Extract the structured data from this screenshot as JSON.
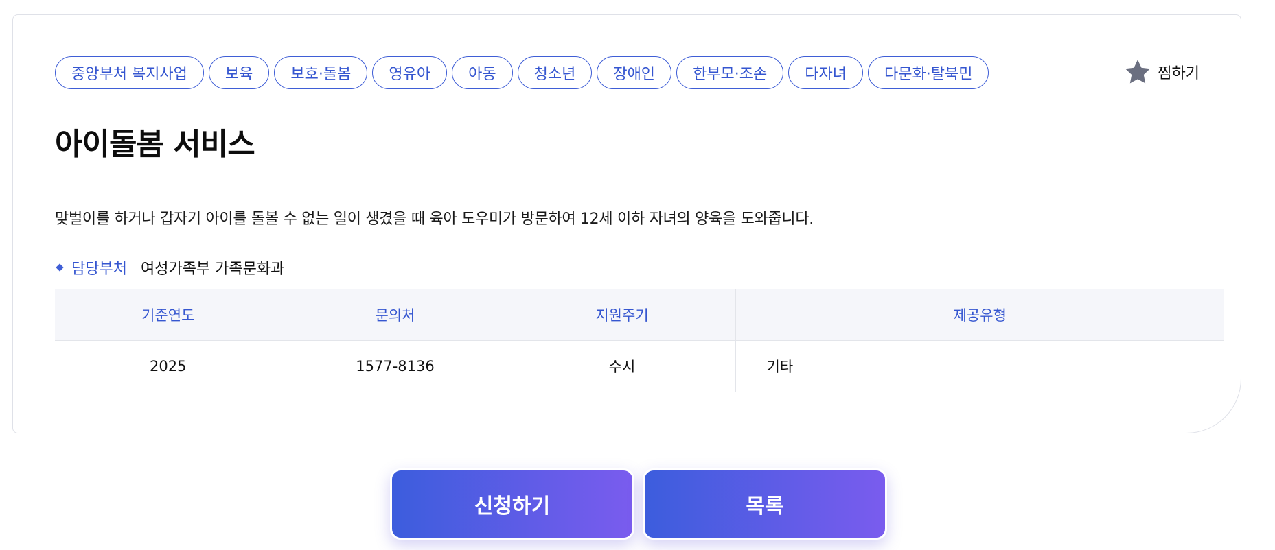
{
  "tags": [
    "중앙부처 복지사업",
    "보육",
    "보호·돌봄",
    "영유아",
    "아동",
    "청소년",
    "장애인",
    "한부모·조손",
    "다자녀",
    "다문화·탈북민"
  ],
  "favorite": {
    "label": "찜하기",
    "icon": "star-icon"
  },
  "title": "아이돌봄 서비스",
  "description": "맞벌이를 하거나 갑자기 아이를 돌볼 수 없는 일이 생겼을 때 육아 도우미가 방문하여 12세 이하 자녀의 양육을 도와줍니다.",
  "department": {
    "label": "담당부처",
    "value": "여성가족부 가족문화과"
  },
  "info_table": {
    "headers": [
      "기준연도",
      "문의처",
      "지원주기",
      "제공유형"
    ],
    "row": [
      "2025",
      "1577-8136",
      "수시",
      "기타"
    ]
  },
  "actions": {
    "apply_label": "신청하기",
    "list_label": "목록"
  },
  "colors": {
    "accent": "#3556d0",
    "button_gradient_start": "#3c5ddd",
    "button_gradient_end": "#7a5cee",
    "star": "#6b6f80"
  }
}
